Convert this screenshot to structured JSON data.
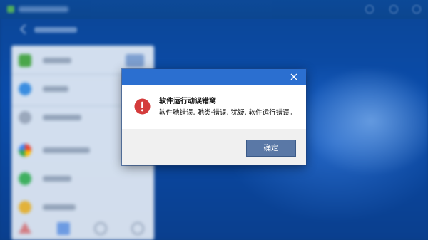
{
  "dialog": {
    "title": "软件运行动误错窝",
    "message": "软件驰错误, 驰类·错误, 犹疑, 软件运行错误。",
    "ok_label": "确定",
    "icon": "error-icon",
    "close_icon": "close-icon"
  },
  "colors": {
    "titlebar": "#2b6fd0",
    "error_red": "#d43b3b",
    "ok_button": "#5a78a6",
    "footer": "#f0f0f0"
  }
}
